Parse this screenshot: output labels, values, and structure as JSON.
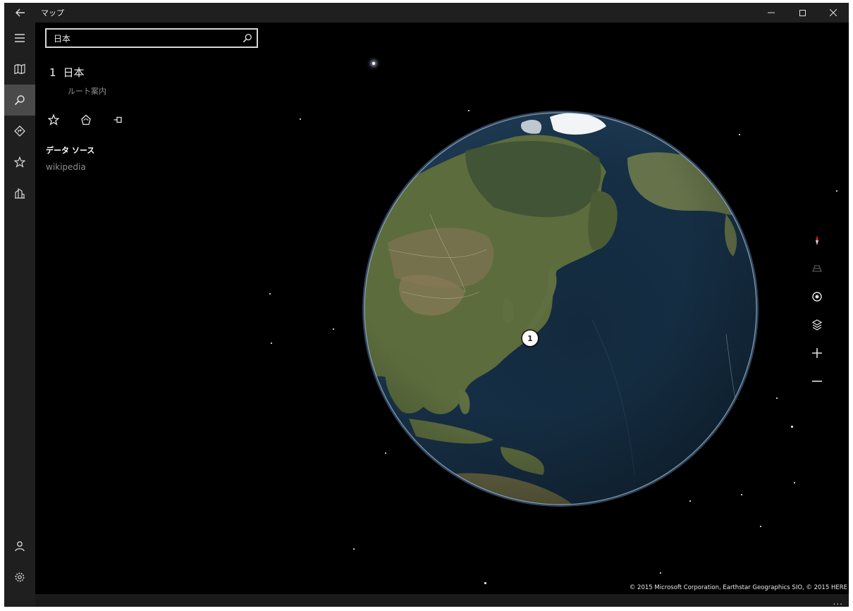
{
  "titlebar": {
    "title": "マップ",
    "back_icon": "arrow-left-icon",
    "minimize_icon": "minimize-icon",
    "maximize_icon": "maximize-icon",
    "close_icon": "close-icon"
  },
  "nav": {
    "items": [
      {
        "name": "menu",
        "icon": "hamburger-icon"
      },
      {
        "name": "map",
        "icon": "map-icon"
      },
      {
        "name": "search",
        "icon": "search-icon",
        "active": true
      },
      {
        "name": "directions",
        "icon": "directions-icon"
      },
      {
        "name": "favorites",
        "icon": "star-icon"
      },
      {
        "name": "3d-cities",
        "icon": "city-icon"
      }
    ],
    "bottom_items": [
      {
        "name": "account",
        "icon": "person-icon"
      },
      {
        "name": "settings",
        "icon": "gear-icon"
      }
    ]
  },
  "search": {
    "value": "日本",
    "placeholder": ""
  },
  "result": {
    "number": "1",
    "title": "日本",
    "directions_label": "ルート案内",
    "actions": [
      "star-icon",
      "share-icon",
      "pin-icon"
    ],
    "data_source_label": "データ ソース",
    "data_source_value": "wikipedia"
  },
  "map": {
    "pin_label": "1",
    "controls": [
      "compass-icon",
      "tilt-icon",
      "location-icon",
      "layers-icon",
      "zoom-in-icon",
      "zoom-out-icon"
    ],
    "copyright": "© 2015 Microsoft Corporation, Earthstar Geographics  SIO, © 2015 HERE"
  },
  "colors": {
    "background": "#000000",
    "chrome": "#1f1f1f",
    "active_nav": "#4a4a4a",
    "ocean": "#1a2f44",
    "land": "#5a6a3e",
    "compass_red": "#e02020"
  },
  "more_label": "..."
}
